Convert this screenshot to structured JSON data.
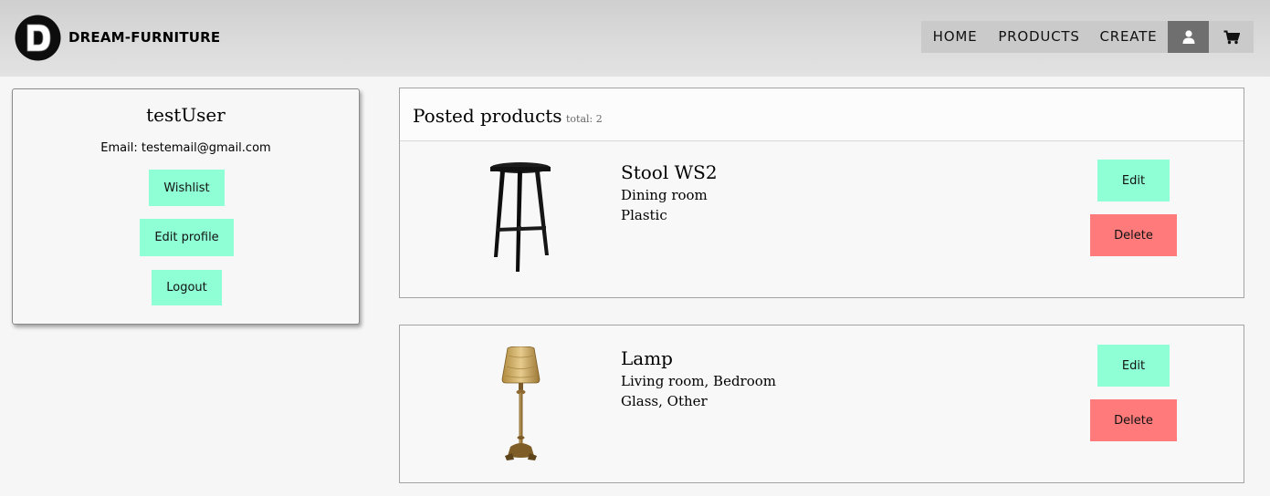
{
  "header": {
    "brand": "DREAM-FURNITURE",
    "logo_letter": "D",
    "nav": {
      "home": "HOME",
      "products": "PRODUCTS",
      "create": "CREATE",
      "user_icon": "user-icon",
      "cart_icon": "cart-icon"
    }
  },
  "profile": {
    "username": "testUser",
    "email_label": "Email:",
    "email": "testemail@gmail.com",
    "wishlist_label": "Wishlist",
    "edit_profile_label": "Edit profile",
    "logout_label": "Logout"
  },
  "posted": {
    "title": "Posted products",
    "total": "total: 2",
    "products": [
      {
        "name": "Stool WS2",
        "rooms": "Dining room",
        "materials": "Plastic",
        "image_icon": "stool-image",
        "edit_label": "Edit",
        "delete_label": "Delete"
      },
      {
        "name": "Lamp",
        "rooms": "Living room, Bedroom",
        "materials": "Glass, Other",
        "image_icon": "lamp-image",
        "edit_label": "Edit",
        "delete_label": "Delete"
      }
    ]
  },
  "colors": {
    "accent_green": "#8fffd5",
    "danger_red": "#ff7b7b",
    "nav_active": "#6f6f6f"
  }
}
